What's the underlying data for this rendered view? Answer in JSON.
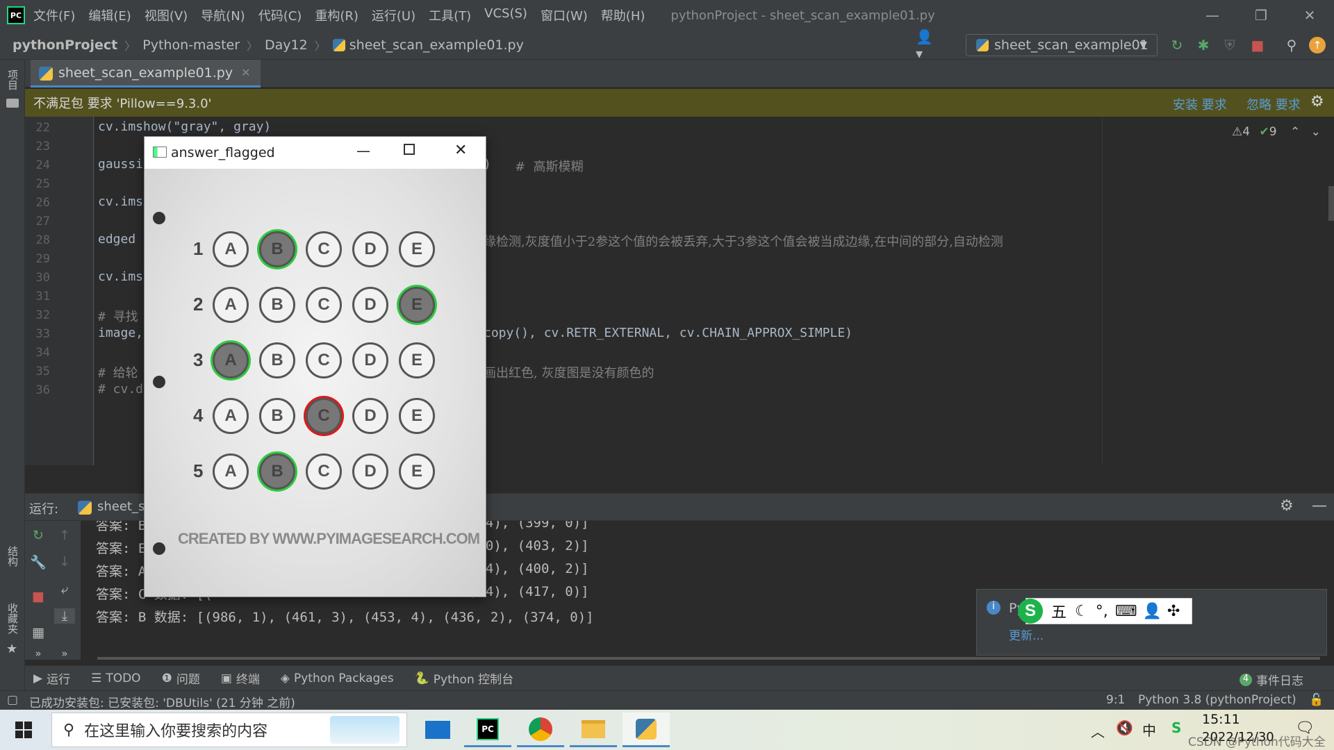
{
  "menubar": {
    "logo": "PC",
    "items": [
      "文件(F)",
      "编辑(E)",
      "视图(V)",
      "导航(N)",
      "代码(C)",
      "重构(R)",
      "运行(U)",
      "工具(T)",
      "VCS(S)",
      "窗口(W)",
      "帮助(H)"
    ],
    "title": "pythonProject - sheet_scan_example01.py"
  },
  "breadcrumb": [
    "pythonProject",
    "Python-master",
    "Day12",
    "sheet_scan_example01.py"
  ],
  "run_config": "sheet_scan_example01",
  "editor_tab": "sheet_scan_example01.py",
  "banner": {
    "text": "不满足包 要求 'Pillow==9.3.0'",
    "install": "安装 要求",
    "ignore": "忽略 要求"
  },
  "inspection": {
    "warnings": "4",
    "ok": "9"
  },
  "code_lines": [
    {
      "n": "22",
      "text": "cv.imshow(\"gray\", gray)"
    },
    {
      "n": "23",
      "text": ""
    },
    {
      "n": "24",
      "text": "gaussi",
      "comment": "#  高斯模糊",
      "tail": ")"
    },
    {
      "n": "25",
      "text": ""
    },
    {
      "n": "26",
      "text": "cv.ims"
    },
    {
      "n": "27",
      "text": ""
    },
    {
      "n": "28",
      "text": "edged",
      "comment": "缘检测,灰度值小于2参这个值的会被丢弃,大于3参这个值会被当成边缘,在中间的部分,自动检测"
    },
    {
      "n": "29",
      "text": ""
    },
    {
      "n": "30",
      "text": "cv.ims"
    },
    {
      "n": "31",
      "text": ""
    },
    {
      "n": "32",
      "text": "# 寻找"
    },
    {
      "n": "33",
      "text": "image,",
      "tail": "copy(), cv.RETR_EXTERNAL, cv.CHAIN_APPROX_SIMPLE)"
    },
    {
      "n": "34",
      "text": ""
    },
    {
      "n": "35",
      "text": "# 给轮",
      "comment": "画出红色, 灰度图是没有颜色的"
    },
    {
      "n": "36",
      "text": "# cv.d"
    }
  ],
  "run_panel": {
    "label": "运行:",
    "tab": "sheet_sc"
  },
  "console_lines": [
    {
      "left": "答案: B",
      "right": ", 4), (399, 0)]"
    },
    {
      "left": "答案: E",
      "right": ", 0), (403, 2)]"
    },
    {
      "left": "答案: A",
      "right": ", 4), (400, 2)]"
    },
    {
      "left": "答案: C 数据: [(",
      "right": ", 4), (417, 0)]"
    },
    {
      "left": "答案: B 数据: [(986, 1), (461, 3), (453, 4), (436, 2), (374, 0)]",
      "right": ""
    }
  ],
  "bottom_tabs": [
    "运行",
    "TODO",
    "问题",
    "终端",
    "Python Packages",
    "Python 控制台"
  ],
  "event_log": {
    "count": "4",
    "label": "事件日志"
  },
  "status": {
    "message": "已成功安装包: 已安装包: 'DBUtils' (21 分钟 之前)",
    "position": "9:1",
    "interpreter": "Python 3.8 (pythonProject)"
  },
  "notification": {
    "title": "PyC",
    "link": "更新..."
  },
  "ime": {
    "mode": "五"
  },
  "side_labels": {
    "project": "项目",
    "structure": "结构",
    "favorites": "收藏夹"
  },
  "cv_window": {
    "title": "answer_flagged",
    "questions": [
      {
        "num": "1",
        "choices": [
          "A",
          "B",
          "C",
          "D",
          "E"
        ],
        "marked": 1,
        "flag": "green"
      },
      {
        "num": "2",
        "choices": [
          "A",
          "B",
          "C",
          "D",
          "E"
        ],
        "marked": 4,
        "flag": "green"
      },
      {
        "num": "3",
        "choices": [
          "A",
          "B",
          "C",
          "D",
          "E"
        ],
        "marked": 0,
        "flag": "green"
      },
      {
        "num": "4",
        "choices": [
          "A",
          "B",
          "C",
          "D",
          "E"
        ],
        "marked": 2,
        "flag": "red"
      },
      {
        "num": "5",
        "choices": [
          "A",
          "B",
          "C",
          "D",
          "E"
        ],
        "marked": 1,
        "flag": "green"
      }
    ],
    "credit": "CREATED BY WWW.PYIMAGESEARCH.COM"
  },
  "taskbar": {
    "search_placeholder": "在这里输入你要搜索的内容",
    "time": "15:11",
    "date": "2022/12/30",
    "lang": "中",
    "watermark": "CSDN @Python代码大全"
  },
  "colors": {
    "accent": "#4a88c7",
    "banner_bg": "#53521e",
    "green_flag": "#2ecc40",
    "red_flag": "#e01818"
  }
}
